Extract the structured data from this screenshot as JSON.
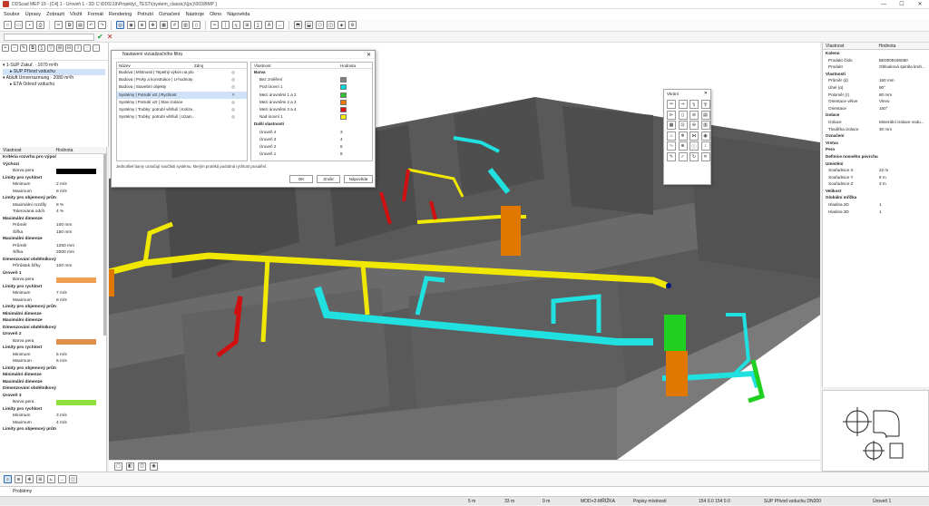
{
  "window": {
    "title": "DDScad MEP 19 - [Č4] 1 - Úroveň 1 - 3D  C:\\DDS\\19\\Projekty\\_TEST\\(system_classic)\\(pc)\\003\\BMP ]",
    "min": "—",
    "max": "☐",
    "close": "✕"
  },
  "menu": [
    "Soubor",
    "Úpravy",
    "Zobrazit",
    "Vložit",
    "Formát",
    "Rendering",
    "Potrubí",
    "Označení",
    "Nástroje",
    "Okno",
    "Nápověda"
  ],
  "tree": [
    {
      "label": "1-SUP Zakuř.  ·  1670 m³/h",
      "selected": false
    },
    {
      "label": "SUP Přívod vzduchu",
      "selected": true
    },
    {
      "label": "Abluft Umrerrazmung  · 2080 m³/h",
      "selected": false
    },
    {
      "label": "ETA Odvod vzduchu",
      "selected": false
    }
  ],
  "props_left": {
    "header": [
      "Vlastnost",
      "Hodnota"
    ],
    "rows": [
      {
        "k": "Kritéria rozvrhu pro výpočet systému",
        "v": "",
        "grp": true
      },
      {
        "k": "Výchozí",
        "v": "",
        "grp": true
      },
      {
        "k": "Barva pera",
        "v": "",
        "color": "#000000"
      },
      {
        "k": "Limity pro rychlost",
        "v": "",
        "grp": true
      },
      {
        "k": "Minimum",
        "v": "2 m/s"
      },
      {
        "k": "Maximum",
        "v": "8 m/s"
      },
      {
        "k": "Limity pro objemový průtok",
        "v": "",
        "grp": true
      },
      {
        "k": "Maximální rozdíly",
        "v": "8 %"
      },
      {
        "k": "Tolerovaná odch.",
        "v": "4 %"
      },
      {
        "k": "Maximální dimenze",
        "v": "",
        "grp": true
      },
      {
        "k": "Průměr",
        "v": "100 mm"
      },
      {
        "k": "Šířka",
        "v": "150 mm"
      },
      {
        "k": "Maximální dimenze",
        "v": "",
        "grp": true
      },
      {
        "k": "Průměr",
        "v": "1250 mm"
      },
      {
        "k": "Šířka",
        "v": "2000 mm"
      },
      {
        "k": "Dimenzování obdélníkových potrubí",
        "v": "",
        "grp": true
      },
      {
        "k": "Přírůstek šířky",
        "v": "100 mm"
      },
      {
        "k": "Úroveň 1",
        "v": "",
        "grp": true
      },
      {
        "k": "Barva pera",
        "v": "",
        "color": "#f0a050"
      },
      {
        "k": "Limity pro rychlost",
        "v": "",
        "grp": true
      },
      {
        "k": "Minimum",
        "v": "7 m/s"
      },
      {
        "k": "Maximum",
        "v": "8 m/s"
      },
      {
        "k": "Limity pro objemový průtok",
        "v": "",
        "grp": true
      },
      {
        "k": "Minimální dimenze",
        "v": "",
        "grp": true
      },
      {
        "k": "Maximální dimenze",
        "v": "",
        "grp": true
      },
      {
        "k": "Dimenzování obdélníkových potrubí",
        "v": "",
        "grp": true
      },
      {
        "k": "Úroveň 2",
        "v": "",
        "grp": true
      },
      {
        "k": "Barva pera",
        "v": "",
        "color": "#e0904a"
      },
      {
        "k": "Limity pro rychlost",
        "v": "",
        "grp": true
      },
      {
        "k": "Minimum",
        "v": "5 m/s"
      },
      {
        "k": "Maximum",
        "v": "6 m/s"
      },
      {
        "k": "Limity pro objemový průtok",
        "v": "",
        "grp": true
      },
      {
        "k": "Minimální dimenze",
        "v": "",
        "grp": true
      },
      {
        "k": "Maximální dimenze",
        "v": "",
        "grp": true
      },
      {
        "k": "Dimenzování obdélníkových potrubí",
        "v": "",
        "grp": true
      },
      {
        "k": "Úroveň 3",
        "v": "",
        "grp": true
      },
      {
        "k": "Barva pera",
        "v": "",
        "color": "#90e040"
      },
      {
        "k": "Limity pro rychlost",
        "v": "",
        "grp": true
      },
      {
        "k": "Minimum",
        "v": "3 m/s"
      },
      {
        "k": "Maximum",
        "v": "4 m/s"
      },
      {
        "k": "Limity pro objemový průtok",
        "v": "",
        "grp": true
      }
    ]
  },
  "dialog": {
    "title": "Nastavení vizualizačního filtru",
    "close": "✕",
    "list_header": [
      "Název",
      "Zdroj"
    ],
    "list": [
      {
        "name": "Budova | Místnosti | Tepelný výkon na plo...",
        "sel": false
      },
      {
        "name": "Budova | Prvky a konstrukce | U-hodnoty",
        "sel": false
      },
      {
        "name": "Budova | Stavební objekty",
        "sel": false
      },
      {
        "name": "Systémy | Potrubí vzt | Rychlost",
        "sel": true
      },
      {
        "name": "Systémy | Potrubí vzt | Stav izolace",
        "sel": false
      },
      {
        "name": "Systémy | Trubky; potrubí většulí | Kolize...",
        "sel": false
      },
      {
        "name": "Systémy | Trubky; potrubí většulí | Uzam...",
        "sel": false
      }
    ],
    "props_header": [
      "Vlastnost",
      "Hodnota"
    ],
    "props": [
      {
        "k": "Barva",
        "grp": true
      },
      {
        "k": "Bez změření",
        "color": "#808080"
      },
      {
        "k": "Pod úrovní 1",
        "color": "#00d8d8"
      },
      {
        "k": "Mezi úrovněmi 1 a 2",
        "color": "#30c030"
      },
      {
        "k": "Mezi úrovněmi 2 a 3",
        "color": "#f07800"
      },
      {
        "k": "Mezi úrovněmi 3 a 4",
        "color": "#e01010"
      },
      {
        "k": "Nad úrovní 1",
        "color": "#f0f000"
      },
      {
        "k": "Další vlastnosti",
        "grp": true
      },
      {
        "k": "Úroveň 4",
        "v": "3"
      },
      {
        "k": "Úroveň 3",
        "v": "4"
      },
      {
        "k": "Úroveň 2",
        "v": "6"
      },
      {
        "k": "Úroveň 1",
        "v": "8"
      }
    ],
    "note": "Jednotlivé barvy označují součásti systému, kterým protéká podobná rychlost proudění.",
    "ok": "OK",
    "apply": "Zrušit",
    "help": "Nápověda"
  },
  "palette": {
    "title": "Vkrání",
    "close": "✕"
  },
  "props_right": {
    "header": [
      "Vlastnost",
      "Hodnota"
    ],
    "rows": [
      {
        "k": "Koleno",
        "v": "",
        "grp": true
      },
      {
        "k": "Produkt číslo",
        "v": "BE0009186080"
      },
      {
        "k": "Produkt",
        "v": "Oblouková spirála kruh..."
      },
      {
        "k": "Vlastnosti",
        "v": "",
        "grp": true
      },
      {
        "k": "Průměr (d)",
        "v": "160 mm"
      },
      {
        "k": "Úhel (α)",
        "v": "90°"
      },
      {
        "k": "Poloměr (r)",
        "v": "80 mm"
      },
      {
        "k": "Orientace větve",
        "v": "Vlevo"
      },
      {
        "k": "Orientace",
        "v": "160°"
      },
      {
        "k": "Izolace",
        "v": "",
        "grp": true
      },
      {
        "k": "Izolace",
        "v": "Minerální izolace vodu..."
      },
      {
        "k": "Tloušťka izolace",
        "v": "30 mm"
      },
      {
        "k": "Označení",
        "v": "",
        "grp": true
      },
      {
        "k": "Vrstva",
        "v": "",
        "grp": true
      },
      {
        "k": "Pero",
        "v": "",
        "grp": true
      },
      {
        "k": "Definice nosného povrchu",
        "v": "",
        "grp": true
      },
      {
        "k": "Umístění",
        "v": "",
        "grp": true
      },
      {
        "k": "Souřadnice X",
        "v": "22 m"
      },
      {
        "k": "Souřadnice Y",
        "v": "8 m"
      },
      {
        "k": "Souřadnice Z",
        "v": "3 m"
      },
      {
        "k": "Velikost",
        "v": "",
        "grp": true
      },
      {
        "k": "Globální mřížka",
        "v": "",
        "grp": true
      },
      {
        "k": "Hladina 2D",
        "v": "1"
      },
      {
        "k": "Hladina 3D",
        "v": "1"
      }
    ]
  },
  "bottom": {
    "problems_tab": "Problémy"
  },
  "status": {
    "s1": "5 m",
    "s2": "33 m",
    "s3": "0 m",
    "s4": "MOD+2-MŘÍŽKA",
    "s5": "Popisy místností",
    "s6": "154  0.0 154   0.0",
    "s7": "SUP Přívod vzduchu DN200",
    "s8": "Úroveň 1"
  },
  "colors": {
    "yellow": "#f0e800",
    "cyan": "#20e0e0",
    "red": "#d01010",
    "orange": "#e07800",
    "green": "#20d020",
    "building": "#5a5a5a"
  }
}
